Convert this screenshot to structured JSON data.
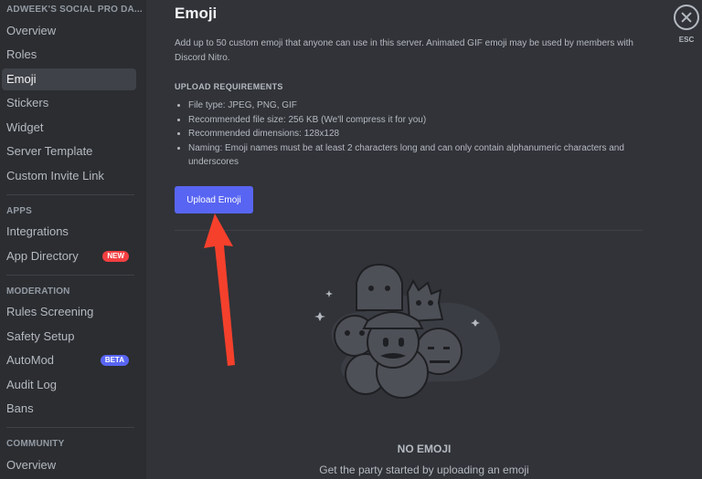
{
  "sidebar": {
    "server_header": "ADWEEK'S SOCIAL PRO DA...",
    "group1": [
      "Overview",
      "Roles",
      "Emoji",
      "Stickers",
      "Widget",
      "Server Template",
      "Custom Invite Link"
    ],
    "apps_header": "APPS",
    "apps": [
      {
        "label": "Integrations"
      },
      {
        "label": "App Directory",
        "badge": "NEW"
      }
    ],
    "moderation_header": "MODERATION",
    "moderation": [
      {
        "label": "Rules Screening"
      },
      {
        "label": "Safety Setup"
      },
      {
        "label": "AutoMod",
        "badge": "BETA"
      },
      {
        "label": "Audit Log"
      },
      {
        "label": "Bans"
      }
    ],
    "community_header": "COMMUNITY",
    "community": [
      "Overview"
    ]
  },
  "main": {
    "title": "Emoji",
    "description": "Add up to 50 custom emoji that anyone can use in this server. Animated GIF emoji may be used by members with Discord Nitro.",
    "requirements_header": "UPLOAD REQUIREMENTS",
    "requirements": [
      "File type: JPEG, PNG, GIF",
      "Recommended file size: 256 KB (We'll compress it for you)",
      "Recommended dimensions: 128x128",
      "Naming: Emoji names must be at least 2 characters long and can only contain alphanumeric characters and underscores"
    ],
    "upload_button": "Upload Emoji",
    "empty_title": "NO EMOJI",
    "empty_subtitle": "Get the party started by uploading an emoji"
  },
  "close": {
    "label": "ESC"
  },
  "colors": {
    "accent": "#5865f2",
    "new_badge": "#f23f42",
    "arrow": "#f5402c",
    "background": "#313338",
    "sidebar": "#2b2d31"
  }
}
